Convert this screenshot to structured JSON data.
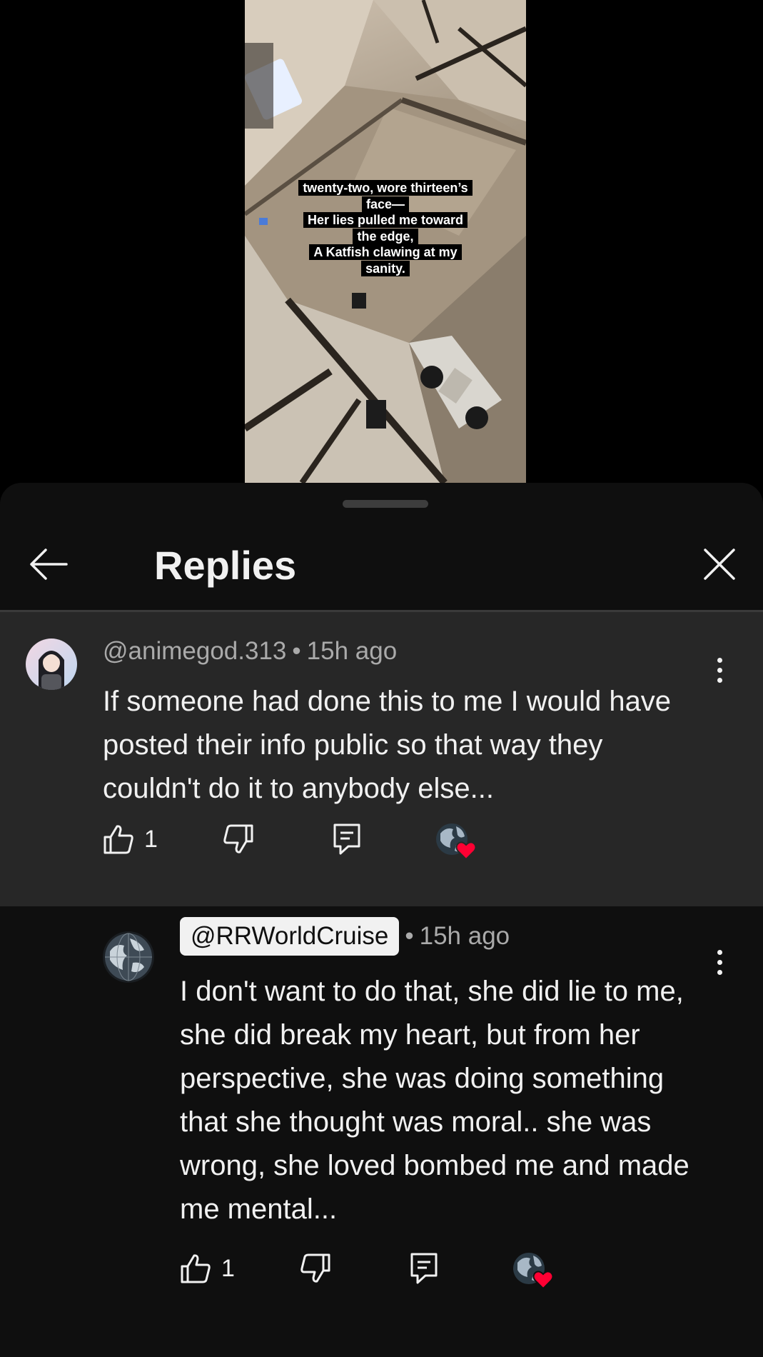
{
  "video": {
    "caption_lines": [
      "twenty-two, wore thirteen’s",
      "face—",
      "Her lies pulled me toward",
      "the edge,",
      "A Katfish clawing at my",
      "sanity."
    ]
  },
  "sheet": {
    "title": "Replies",
    "back_icon": "arrow-left-icon",
    "close_icon": "close-icon"
  },
  "parent_comment": {
    "author": "@animegod.313",
    "separator": "•",
    "time": "15h ago",
    "text": "If someone had done this to me I would have\nposted their info public so that way they\ncouldn't do it to anybody else...",
    "like_count": "1",
    "icons": [
      "thumb-up-icon",
      "thumb-down-icon",
      "reply-icon",
      "creator-heart-icon",
      "more-vert-icon"
    ]
  },
  "reply_comment": {
    "author": "@RRWorldCruise",
    "separator": "•",
    "time": "15h ago",
    "text": "I don't want to do that, she did lie to me,\nshe did break my heart, but from her\nperspective, she was doing something\nthat she thought was moral.. she was\nwrong, she loved bombed me and made\nme mental...",
    "like_count": "1",
    "icons": [
      "thumb-up-icon",
      "thumb-down-icon",
      "reply-icon",
      "creator-heart-icon",
      "more-vert-icon"
    ]
  },
  "colors": {
    "sheet_bg": "#0f0f0f",
    "highlight_bg": "#272727",
    "meta_text": "#aaaaaa",
    "heart": "#ff0033"
  }
}
